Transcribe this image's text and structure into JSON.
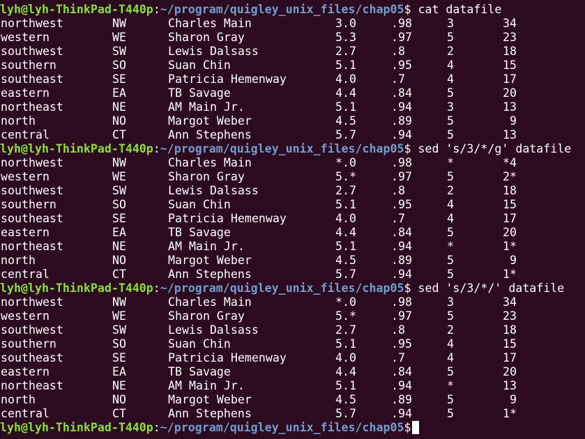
{
  "prompt": {
    "user_host": "lyh@lyh-ThinkPad-T440p",
    "separator": ":",
    "path": "~/program/quigley_unix_files/chap05",
    "dollar": "$"
  },
  "blocks": [
    {
      "command": " cat datafile",
      "rows": [
        [
          "northwest",
          "NW",
          "Charles Main",
          "3.0",
          ".98",
          "3",
          "34"
        ],
        [
          "western",
          "WE",
          "Sharon Gray",
          "5.3",
          ".97",
          "5",
          "23"
        ],
        [
          "southwest",
          "SW",
          "Lewis Dalsass",
          "2.7",
          ".8",
          "2",
          "18"
        ],
        [
          "southern",
          "SO",
          "Suan Chin",
          "5.1",
          ".95",
          "4",
          "15"
        ],
        [
          "southeast",
          "SE",
          "Patricia Hemenway",
          "4.0",
          ".7",
          "4",
          "17"
        ],
        [
          "eastern",
          "EA",
          "TB Savage",
          "4.4",
          ".84",
          "5",
          "20"
        ],
        [
          "northeast",
          "NE",
          "AM Main Jr.",
          "5.1",
          ".94",
          "3",
          "13"
        ],
        [
          "north",
          "NO",
          "Margot Weber",
          "4.5",
          ".89",
          "5",
          "9"
        ],
        [
          "central",
          "CT",
          "Ann Stephens",
          "5.7",
          ".94",
          "5",
          "13"
        ]
      ]
    },
    {
      "command": " sed 's/3/*/g' datafile",
      "rows": [
        [
          "northwest",
          "NW",
          "Charles Main",
          "*.0",
          ".98",
          "*",
          "*4"
        ],
        [
          "western",
          "WE",
          "Sharon Gray",
          "5.*",
          ".97",
          "5",
          "2*"
        ],
        [
          "southwest",
          "SW",
          "Lewis Dalsass",
          "2.7",
          ".8",
          "2",
          "18"
        ],
        [
          "southern",
          "SO",
          "Suan Chin",
          "5.1",
          ".95",
          "4",
          "15"
        ],
        [
          "southeast",
          "SE",
          "Patricia Hemenway",
          "4.0",
          ".7",
          "4",
          "17"
        ],
        [
          "eastern",
          "EA",
          "TB Savage",
          "4.4",
          ".84",
          "5",
          "20"
        ],
        [
          "northeast",
          "NE",
          "AM Main Jr.",
          "5.1",
          ".94",
          "*",
          "1*"
        ],
        [
          "north",
          "NO",
          "Margot Weber",
          "4.5",
          ".89",
          "5",
          "9"
        ],
        [
          "central",
          "CT",
          "Ann Stephens",
          "5.7",
          ".94",
          "5",
          "1*"
        ]
      ]
    },
    {
      "command": " sed 's/3/*/' datafile",
      "rows": [
        [
          "northwest",
          "NW",
          "Charles Main",
          "*.0",
          ".98",
          "3",
          "34"
        ],
        [
          "western",
          "WE",
          "Sharon Gray",
          "5.*",
          ".97",
          "5",
          "23"
        ],
        [
          "southwest",
          "SW",
          "Lewis Dalsass",
          "2.7",
          ".8",
          "2",
          "18"
        ],
        [
          "southern",
          "SO",
          "Suan Chin",
          "5.1",
          ".95",
          "4",
          "15"
        ],
        [
          "southeast",
          "SE",
          "Patricia Hemenway",
          "4.0",
          ".7",
          "4",
          "17"
        ],
        [
          "eastern",
          "EA",
          "TB Savage",
          "4.4",
          ".84",
          "5",
          "20"
        ],
        [
          "northeast",
          "NE",
          "AM Main Jr.",
          "5.1",
          ".94",
          "*",
          "13"
        ],
        [
          "north",
          "NO",
          "Margot Weber",
          "4.5",
          ".89",
          "5",
          "9"
        ],
        [
          "central",
          "CT",
          "Ann Stephens",
          "5.7",
          ".94",
          "5",
          "1*"
        ]
      ]
    }
  ],
  "colors": {
    "background": "#2c0a20",
    "text": "#ffffff",
    "prompt_user": "#8ae234",
    "prompt_path": "#729fcf"
  }
}
